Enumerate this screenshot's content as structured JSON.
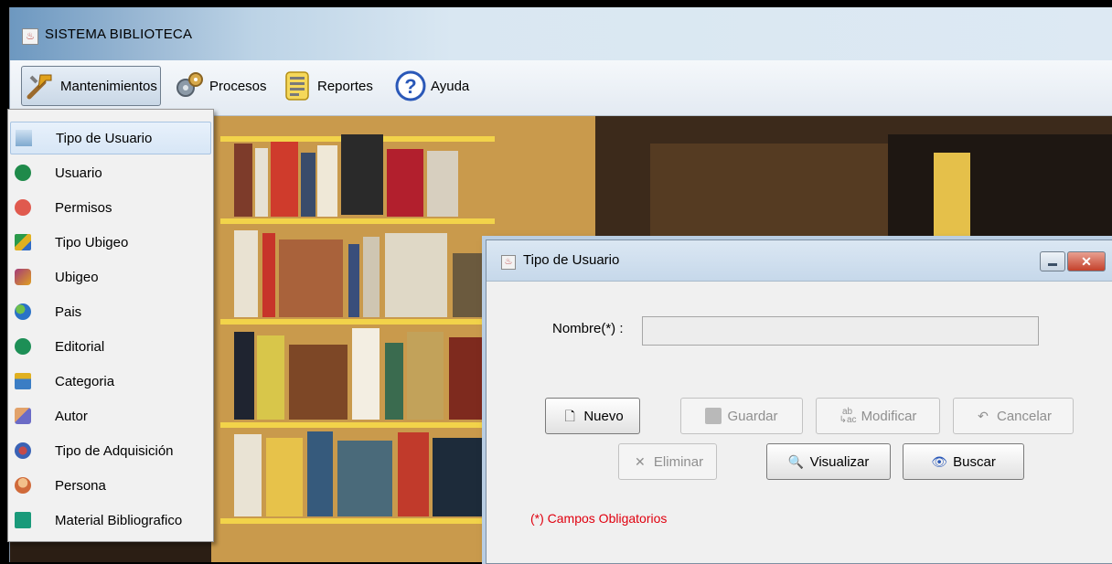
{
  "app": {
    "title": "SISTEMA BIBLIOTECA"
  },
  "menubar": {
    "items": [
      {
        "label": "Mantenimientos",
        "icon": "tools-icon"
      },
      {
        "label": "Procesos",
        "icon": "gears-icon"
      },
      {
        "label": "Reportes",
        "icon": "report-icon"
      },
      {
        "label": "Ayuda",
        "icon": "help-icon"
      }
    ]
  },
  "dropdown": {
    "items": [
      {
        "label": "Tipo de Usuario",
        "icon": "user-type-icon",
        "color": "#7fa9cf"
      },
      {
        "label": "Usuario",
        "icon": "user-icon",
        "color": "#1f8a4a"
      },
      {
        "label": "Permisos",
        "icon": "permissions-icon",
        "color": "#e05a4e"
      },
      {
        "label": "Tipo Ubigeo",
        "icon": "map-icon",
        "color": "#e0b020"
      },
      {
        "label": "Ubigeo",
        "icon": "location-icon",
        "color": "#a33a7a"
      },
      {
        "label": "Pais",
        "icon": "globe-icon",
        "color": "#2a72c7"
      },
      {
        "label": "Editorial",
        "icon": "editorial-icon",
        "color": "#1d8f56"
      },
      {
        "label": "Categoria",
        "icon": "category-icon",
        "color": "#3b7dc4"
      },
      {
        "label": "Autor",
        "icon": "author-icon",
        "color": "#6b6bc6"
      },
      {
        "label": "Tipo de Adquisición",
        "icon": "acquisition-icon",
        "color": "#3a62b5"
      },
      {
        "label": "Persona",
        "icon": "person-icon",
        "color": "#e2a26a"
      },
      {
        "label": "Material Bibliografico",
        "icon": "book-icon",
        "color": "#1a9a7a"
      }
    ]
  },
  "dialog": {
    "title": "Tipo de Usuario",
    "nombre_label": "Nombre(*) :",
    "nombre_value": "",
    "buttons": {
      "nuevo": "Nuevo",
      "guardar": "Guardar",
      "modificar": "Modificar",
      "cancelar": "Cancelar",
      "eliminar": "Eliminar",
      "visualizar": "Visualizar",
      "buscar": "Buscar"
    },
    "required_note": "(*) Campos Obligatorios"
  }
}
